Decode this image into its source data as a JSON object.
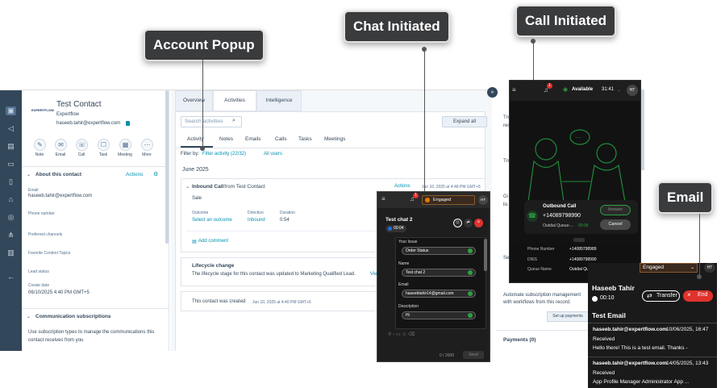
{
  "callouts": {
    "account_popup": "Account Popup",
    "chat_initiated": "Chat Initiated",
    "call_initiated": "Call Initiated",
    "email": "Email"
  },
  "contact": {
    "name": "Test Contact",
    "company": "Expertflow",
    "email": "haseeb.tahir@expertflow.com",
    "logo_text": "EXPERTFLOW",
    "actions": [
      "Note",
      "Email",
      "Call",
      "Task",
      "Meeting",
      "More"
    ],
    "about_title": "About this contact",
    "actions_link": "Actions",
    "fields": [
      {
        "label": "Email",
        "value": "haseeb.tahir@expertflow.com"
      },
      {
        "label": "Phone number",
        "value": ""
      },
      {
        "label": "Preferred channels",
        "value": ""
      },
      {
        "label": "Favorite Content Topics",
        "value": ""
      },
      {
        "label": "Lead status",
        "value": ""
      },
      {
        "label": "Create date",
        "value": "06/10/2025 4:40 PM GMT+5"
      }
    ],
    "comm_title": "Communication subscriptions",
    "comm_text": "Use subscription types to manage the communications this contact receives from you"
  },
  "main": {
    "tabs": [
      "Overview",
      "Activities",
      "Intelligence"
    ],
    "search_placeholder": "Search activities",
    "expand_all": "Expand all",
    "subtabs": [
      "Activity",
      "Notes",
      "Emails",
      "Calls",
      "Tasks",
      "Meetings"
    ],
    "filter_by": "Filter by:",
    "filter_activity": "Filter activity (22/32)",
    "all_users": "All users",
    "month": "June 2025",
    "call_title_bold": "Inbound Call",
    "call_title_rest": "from Test Contact",
    "call_actions": "Actions",
    "call_date": "Jun 10, 2025 at 4:48 PM GMT+5",
    "call_desc": "Sale",
    "outcome_label": "Outcome",
    "outcome_value": "Select an outcome",
    "direction_label": "Direction",
    "direction_value": "Inbound",
    "duration_label": "Duration",
    "duration_value": "0:54",
    "add_comment": "Add comment",
    "lifecycle_title": "Lifecycle change",
    "lifecycle_text": "The lifecycle stage for this contact was updated to Marketing Qualified Lead.",
    "lifecycle_link": "View",
    "created_text": "This contact was created",
    "created_date": "Jun 10, 2025 at 4:40 PM GMT+5"
  },
  "chat": {
    "status": "Engaged",
    "avatar": "HT",
    "badge": "1",
    "title": "Test chat 2",
    "timer": "00:04",
    "form": [
      {
        "label": "Your Issue",
        "value": "Order Status"
      },
      {
        "label": "Name",
        "value": "Test chat 2"
      },
      {
        "label": "Email",
        "value": "haseebtahir14@gmail.com"
      },
      {
        "label": "Description",
        "value": "Hi"
      }
    ],
    "counter": "0 / 2000",
    "send": "Send"
  },
  "call": {
    "status": "Available",
    "timer_top": "31:41",
    "avatar": "HT",
    "badge": "1",
    "title": "Outbound Call",
    "number": "+14089798990",
    "queue_line": "Outdial Queue-...",
    "timer": "00:05",
    "answer": "Answer",
    "cancel": "Cancel",
    "details": [
      {
        "label": "Phone Number",
        "value": "+14089798989"
      },
      {
        "label": "DNIS",
        "value": "+14089798990"
      },
      {
        "label": "Queue Name",
        "value": "Outdial Queue-1"
      }
    ]
  },
  "right_strip": {
    "text1": "Tro",
    "text1b": "rec",
    "text2": "Tro",
    "text3": "Gi",
    "text3b": "lis",
    "text4": "Se",
    "automate": "Automate subscription management with workflows from this record.",
    "setup": "Set up payments",
    "payments": "Payments (0)"
  },
  "email": {
    "status": "Engaged",
    "avatar": "HT",
    "agent": "Haseeb Tahir",
    "timer": "00:10",
    "transfer": "Transfer",
    "end": "End",
    "title": "Test Email",
    "messages": [
      {
        "from": "haseeb.tahir@expertflow.com",
        "date": "10/06/2025, 16:47",
        "status": "Received",
        "body": "Hello there! This is a test email. Thanks -"
      },
      {
        "from": "haseeb.tahir@expertflow.com",
        "date": "14/05/2025, 13:43",
        "status": "Received",
        "body": "App Profile Manager Administrator App ..."
      }
    ]
  }
}
